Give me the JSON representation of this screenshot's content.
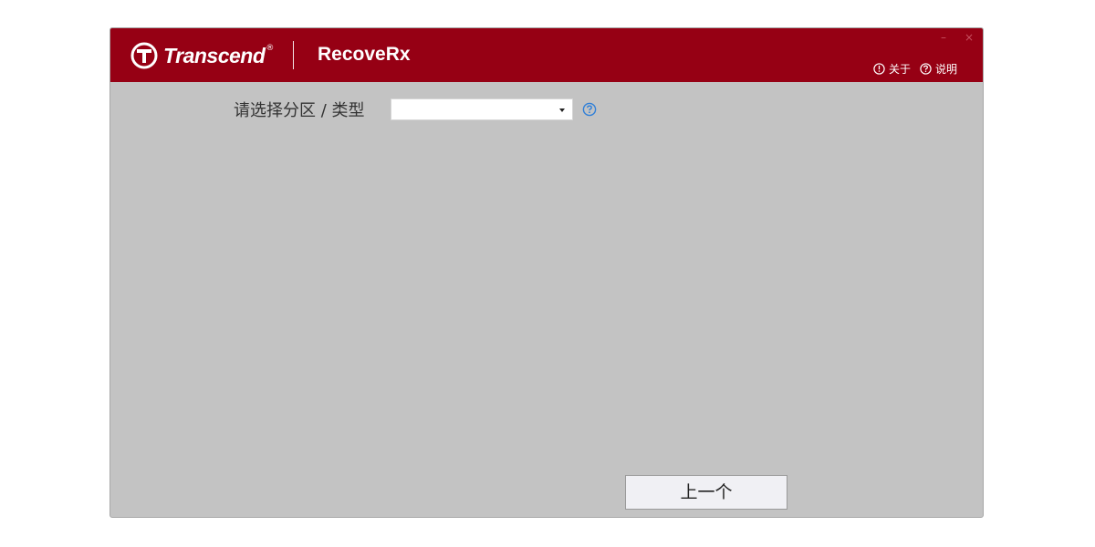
{
  "window": {
    "brand": "Transcend",
    "brand_mark": "®",
    "app_name": "RecoveRx",
    "controls": {
      "minimize": "–",
      "close": "×"
    },
    "header_links": {
      "about_label": "关于",
      "help_label": "说明"
    }
  },
  "form": {
    "partition_label": "请选择分区 / 类型",
    "partition_value": ""
  },
  "footer": {
    "prev_button_label": "上一个"
  },
  "colors": {
    "titlebar": "#960014",
    "body": "#c3c3c3",
    "help_icon": "#2f7fd8"
  },
  "icons": {
    "logo": "transcend-logo-icon",
    "about": "info-circle-icon",
    "help": "question-circle-icon",
    "dropdown": "chevron-down-icon",
    "field_help": "question-circle-icon"
  }
}
